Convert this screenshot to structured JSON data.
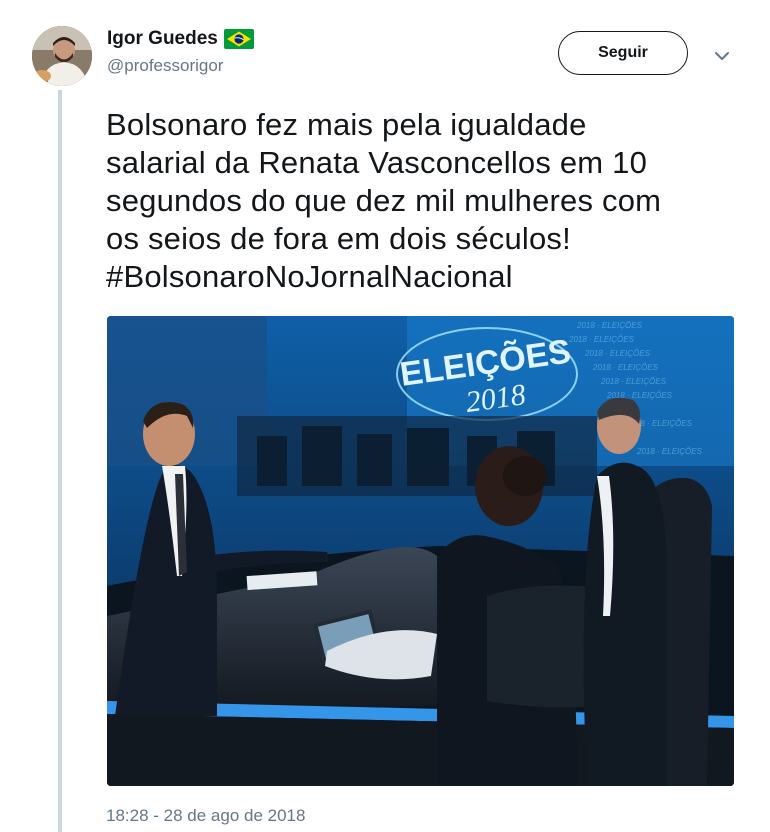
{
  "author": {
    "display_name": "Igor Guedes",
    "handle": "@professorigor",
    "flag_icon": "brazil-flag-icon"
  },
  "follow_button": {
    "label": "Seguir"
  },
  "tweet": {
    "lines": [
      "Bolsonaro fez mais pela igualdade",
      "salarial da Renata Vasconcellos em 10",
      "segundos do que dez mil mulheres com",
      "os seios de fora em dois séculos!",
      "#BolsonaroNoJornalNacional"
    ],
    "hashtag": "#BolsonaroNoJornalNacional"
  },
  "media": {
    "logo_line1": "ELEIÇÕES",
    "logo_line2": "2018",
    "pattern_text": "2018 · ELEIÇÕES"
  },
  "timestamp": "18:28 - 28 de ago de 2018",
  "colors": {
    "text": "#14171a",
    "secondary": "#657786",
    "thread_line": "#ccd6dd",
    "hashtag": "#14171a",
    "flag_green": "#009b3a",
    "flag_yellow": "#fedf00",
    "flag_blue": "#002776"
  }
}
